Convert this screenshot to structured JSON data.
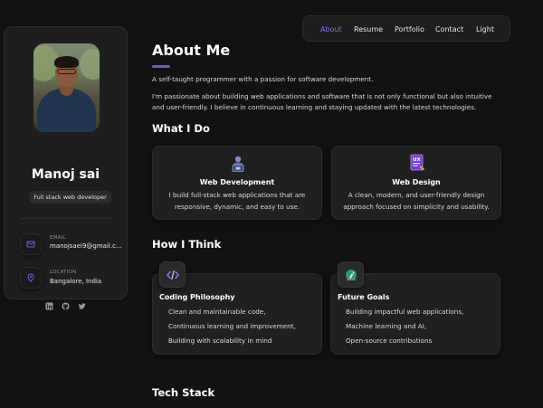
{
  "profile": {
    "name": "Manoj sai",
    "role": "Full stack web developer",
    "email_label": "EMAIL",
    "email_value": "manojsaei9@gmail.c...",
    "location_label": "LOCATION",
    "location_value": "Bangalore, India",
    "socials": [
      "linkedin-icon",
      "github-icon",
      "twitter-icon"
    ]
  },
  "nav": {
    "items": [
      "About",
      "Resume",
      "Portfolio",
      "Contact",
      "Light"
    ],
    "active": "About",
    "accent": "#8c6ce0"
  },
  "about": {
    "title": "About Me",
    "intro": "A self-taught programmer with a passion for software development.",
    "body": "I'm passionate about building web applications and software that is not only functional but also intuitive and user-friendly. I believe in continuous learning and staying updated with the latest technologies."
  },
  "what_i_do": {
    "title": "What I Do",
    "cards": [
      {
        "icon": "developer-icon",
        "title": "Web Development",
        "desc": "I build full-stack web applications that are responsive, dynamic, and easy to use."
      },
      {
        "icon": "ux-design-icon",
        "title": "Web Design",
        "desc": "A clean, modern, and user-friendly design approach focused on simplicity and usability."
      }
    ]
  },
  "how_i_think": {
    "title": "How I Think",
    "cards": [
      {
        "icon": "code-icon",
        "title": "Coding Philosophy",
        "items": [
          "Clean and maintainable code,",
          "Continuous learning and improvement,",
          "Building with scalability in mind"
        ]
      },
      {
        "icon": "rocket-icon",
        "title": "Future Goals",
        "items": [
          "Building impactful web applications,",
          "Machine learning and AI,",
          "Open-source contributions"
        ]
      }
    ]
  },
  "tech_stack": {
    "title": "Tech Stack"
  }
}
